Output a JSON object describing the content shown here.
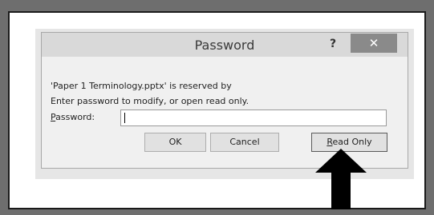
{
  "dialog": {
    "title": "Password",
    "help_label": "?",
    "close_label": "✕",
    "message_line1": "'Paper 1 Terminology.pptx' is reserved by",
    "message_line2": "Enter password to modify, or open read only.",
    "password_label_access_key": "P",
    "password_label_rest": "assword:",
    "password_value": "",
    "buttons": {
      "ok": "OK",
      "cancel": "Cancel",
      "read_only_access_key": "R",
      "read_only_rest": "ead Only"
    }
  },
  "icons": {
    "pointer": "arrow-up-icon"
  },
  "colors": {
    "background": "#6e6e6e",
    "close_button": "#8a8a8a",
    "arrow": "#000000"
  }
}
